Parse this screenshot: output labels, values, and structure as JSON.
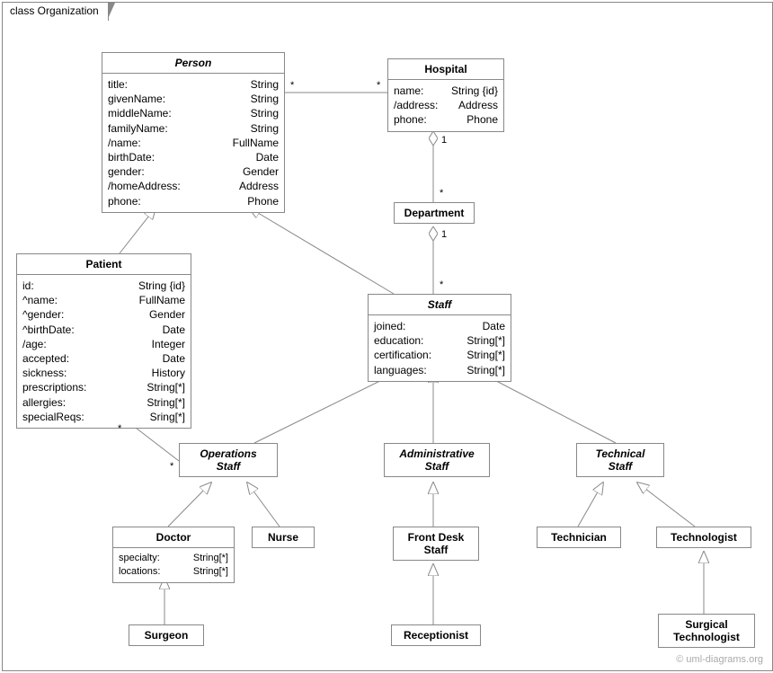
{
  "frame": {
    "label": "class Organization"
  },
  "watermark": "© uml-diagrams.org",
  "classes": {
    "person": {
      "title": "Person",
      "attrs": [
        {
          "name": "title:",
          "type": "String"
        },
        {
          "name": "givenName:",
          "type": "String"
        },
        {
          "name": "middleName:",
          "type": "String"
        },
        {
          "name": "familyName:",
          "type": "String"
        },
        {
          "name": "/name:",
          "type": "FullName"
        },
        {
          "name": "birthDate:",
          "type": "Date"
        },
        {
          "name": "gender:",
          "type": "Gender"
        },
        {
          "name": "/homeAddress:",
          "type": "Address"
        },
        {
          "name": "phone:",
          "type": "Phone"
        }
      ]
    },
    "hospital": {
      "title": "Hospital",
      "attrs": [
        {
          "name": "name:",
          "type": "String {id}"
        },
        {
          "name": "/address:",
          "type": "Address"
        },
        {
          "name": "phone:",
          "type": "Phone"
        }
      ]
    },
    "department": {
      "title": "Department"
    },
    "patient": {
      "title": "Patient",
      "attrs": [
        {
          "name": "id:",
          "type": "String {id}"
        },
        {
          "name": "^name:",
          "type": "FullName"
        },
        {
          "name": "^gender:",
          "type": "Gender"
        },
        {
          "name": "^birthDate:",
          "type": "Date"
        },
        {
          "name": "/age:",
          "type": "Integer"
        },
        {
          "name": "accepted:",
          "type": "Date"
        },
        {
          "name": "sickness:",
          "type": "History"
        },
        {
          "name": "prescriptions:",
          "type": "String[*]"
        },
        {
          "name": "allergies:",
          "type": "String[*]"
        },
        {
          "name": "specialReqs:",
          "type": "Sring[*]"
        }
      ]
    },
    "staff": {
      "title": "Staff",
      "attrs": [
        {
          "name": "joined:",
          "type": "Date"
        },
        {
          "name": "education:",
          "type": "String[*]"
        },
        {
          "name": "certification:",
          "type": "String[*]"
        },
        {
          "name": "languages:",
          "type": "String[*]"
        }
      ]
    },
    "opsStaff": {
      "title": "Operations\nStaff"
    },
    "adminStaff": {
      "title": "Administrative\nStaff"
    },
    "techStaff": {
      "title": "Technical\nStaff"
    },
    "doctor": {
      "title": "Doctor",
      "attrs": [
        {
          "name": "specialty:",
          "type": "String[*]"
        },
        {
          "name": "locations:",
          "type": "String[*]"
        }
      ]
    },
    "nurse": {
      "title": "Nurse"
    },
    "frontDesk": {
      "title": "Front Desk\nStaff"
    },
    "technician": {
      "title": "Technician"
    },
    "technologist": {
      "title": "Technologist"
    },
    "surgeon": {
      "title": "Surgeon"
    },
    "receptionist": {
      "title": "Receptionist"
    },
    "surgTech": {
      "title": "Surgical\nTechnologist"
    }
  },
  "mult": {
    "personHospL": "*",
    "personHospR": "*",
    "hospDept": "1",
    "deptTop": "*",
    "deptStaff": "1",
    "staffTop": "*",
    "patientOpsL": "*",
    "patientOpsR": "*"
  }
}
